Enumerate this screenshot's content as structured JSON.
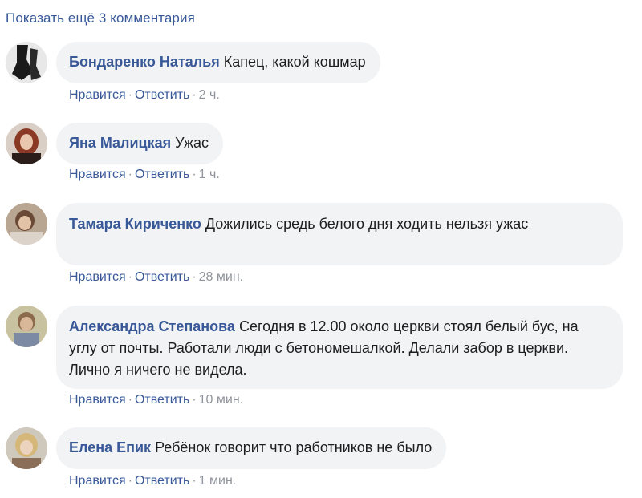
{
  "show_more": "Показать ещё 3 комментария",
  "action_labels": {
    "like": "Нравится",
    "reply": "Ответить"
  },
  "comments": [
    {
      "author": "Бондаренко Наталья",
      "text": "Капец, какой кошмар",
      "time": "2 ч."
    },
    {
      "author": "Яна Малицкая",
      "text": "Ужас",
      "time": "1 ч."
    },
    {
      "author": "Тамара Кириченко",
      "text": "Дожились средь белого дня ходить нельзя ужас",
      "time": "28 мин."
    },
    {
      "author": "Александра Степанова",
      "text": "Сегодня в 12.00 около церкви стоял белый бус, на углу от почты. Работали люди с бетономешалкой. Делали забор в церкви. Лично я ничего не видела.",
      "time": "10 мин."
    },
    {
      "author": "Елена Епик",
      "text": "Ребёнок говорит что работников не было",
      "time": "1 мин."
    }
  ],
  "colors": {
    "link": "#385898",
    "bubble": "#f2f3f5",
    "meta": "#90949c",
    "text": "#1c1e21"
  }
}
